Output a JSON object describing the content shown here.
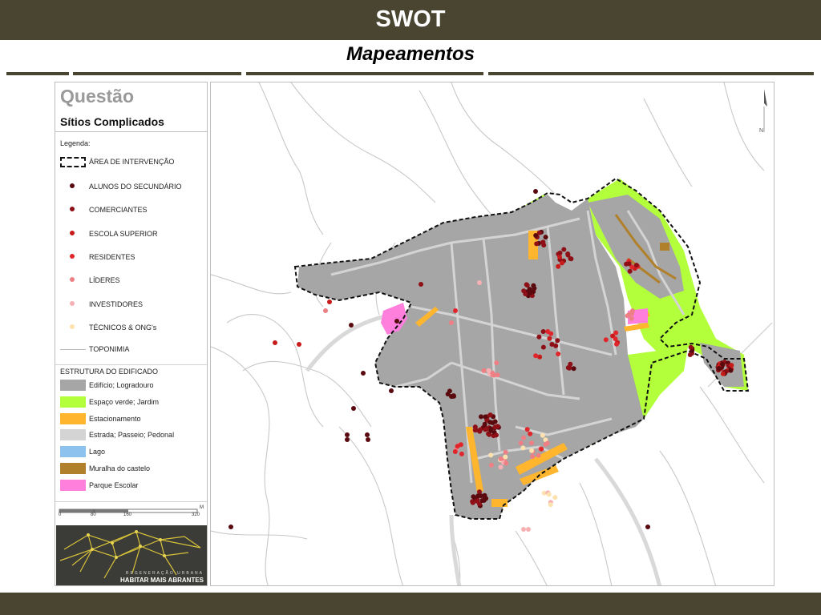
{
  "header": {
    "title": "SWOT",
    "subtitle": "Mapeamentos"
  },
  "colors": {
    "brand_bar": "#4a4530",
    "building": "#a6a6a6",
    "green": "#b3ff3c",
    "parking": "#ffb52e",
    "road": "#d4d4d4",
    "lake": "#8ec2ee",
    "wall": "#b0802a",
    "school": "#ff7fdc"
  },
  "legend": {
    "title": "Questão",
    "subtitle": "Sítios Complicados",
    "caption": "Legenda:",
    "intervention_area": "ÁREA DE INTERVENÇÃO",
    "point_items": [
      {
        "label": "ALUNOS DO SECUNDÁRIO",
        "color": "#5a0a0f"
      },
      {
        "label": "COMERCIANTES",
        "color": "#8e0f16"
      },
      {
        "label": "ESCOLA SUPERIOR",
        "color": "#c81b1b"
      },
      {
        "label": "RESIDENTES",
        "color": "#e0262a"
      },
      {
        "label": "LÍDERES",
        "color": "#ee7f85"
      },
      {
        "label": "INVESTIDORES",
        "color": "#f7b0b3"
      },
      {
        "label": "TÉCNICOS & ONG's",
        "color": "#fde2b0"
      }
    ],
    "toponymy": "TOPONIMIA",
    "structure_heading": "ESTRUTURA DO EDIFICADO",
    "area_items": [
      {
        "label": "Edifício; Logradouro",
        "color": "#a6a6a6"
      },
      {
        "label": "Espaço verde; Jardim",
        "color": "#b3ff3c"
      },
      {
        "label": "Estacionamento",
        "color": "#ffb52e"
      },
      {
        "label": "Estrada; Passeio; Pedonal",
        "color": "#d4d4d4"
      },
      {
        "label": "Lago",
        "color": "#8ec2ee"
      },
      {
        "label": "Muralha do castelo",
        "color": "#b0802a"
      },
      {
        "label": "Parque Escolar",
        "color": "#ff7fdc"
      }
    ],
    "scale": {
      "unit": "M",
      "ticks": [
        "0",
        "80",
        "160",
        "320"
      ]
    },
    "logo": {
      "line1": "REGENERAÇÃO URBANA",
      "line2": "HABITAR MAIS ABRANTES"
    }
  },
  "map": {
    "north_label": "N"
  }
}
